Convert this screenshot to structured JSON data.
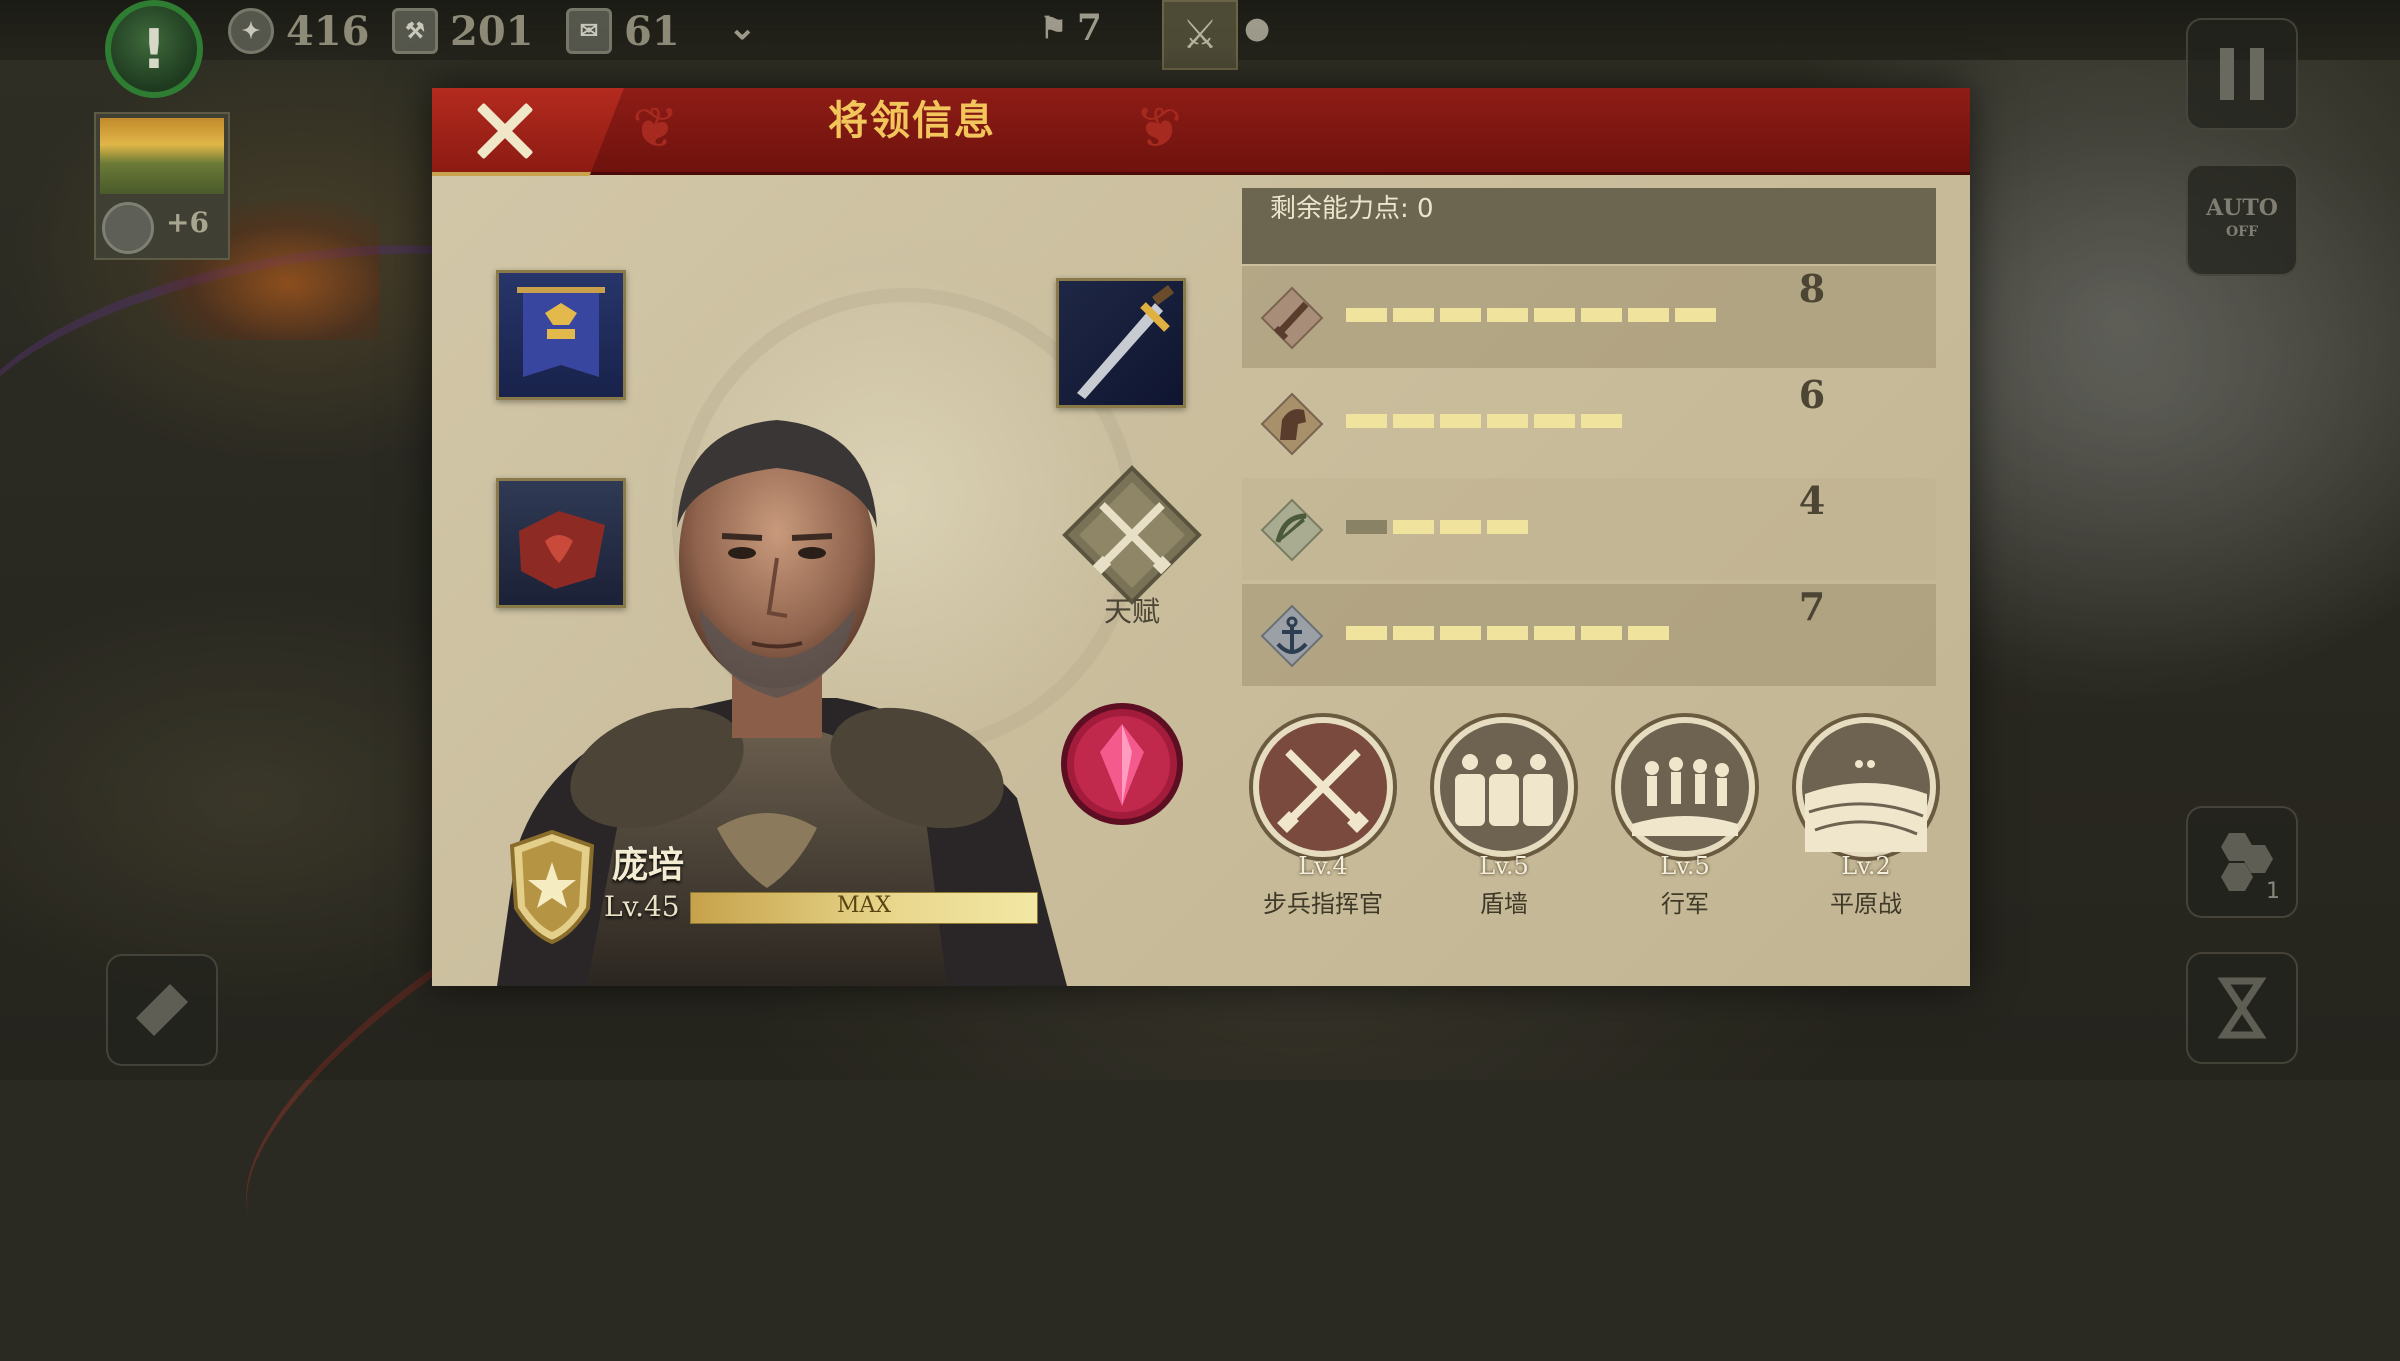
{
  "hud": {
    "resources": [
      {
        "icon": "eagle-coin-icon",
        "value": "416"
      },
      {
        "icon": "hammer-icon",
        "value": "201"
      },
      {
        "icon": "scroll-icon",
        "value": "61"
      }
    ],
    "troops_count": "7"
  },
  "city": {
    "bonus": "+6"
  },
  "right_buttons": {
    "auto_label": "AUTO",
    "auto_state": "OFF",
    "hex_count": "1"
  },
  "modal": {
    "title": "将领信息",
    "general": {
      "name": "庞培",
      "level": "Lv.45",
      "xp_label": "MAX",
      "xp_fraction": 1.0
    },
    "talent_label": "天赋",
    "points": {
      "label": "剩余能力点: 0"
    },
    "stats": [
      {
        "icon": "sword-icon",
        "value": 8,
        "filled": 8,
        "total": 8
      },
      {
        "icon": "horse-head-icon",
        "value": 6,
        "filled": 6,
        "total": 6
      },
      {
        "icon": "bow-icon",
        "value": 4,
        "filled": 4,
        "total": 6
      },
      {
        "icon": "anchor-icon",
        "value": 7,
        "filled": 7,
        "total": 7
      }
    ],
    "skills": [
      {
        "icon": "crossed-swords-icon",
        "level": "Lv.4",
        "name": "步兵指挥官"
      },
      {
        "icon": "shield-wall-icon",
        "level": "Lv.5",
        "name": "盾墙"
      },
      {
        "icon": "march-icon",
        "level": "Lv.5",
        "name": "行军"
      },
      {
        "icon": "plains-icon",
        "level": "Lv.2",
        "name": "平原战"
      }
    ]
  },
  "colors": {
    "header_red": "#7a1611",
    "gold_title": "#f2c65a",
    "pip_on": "#f0e39e",
    "pip_off": "#8a8264",
    "panel_bg": "#c9bd9c"
  }
}
